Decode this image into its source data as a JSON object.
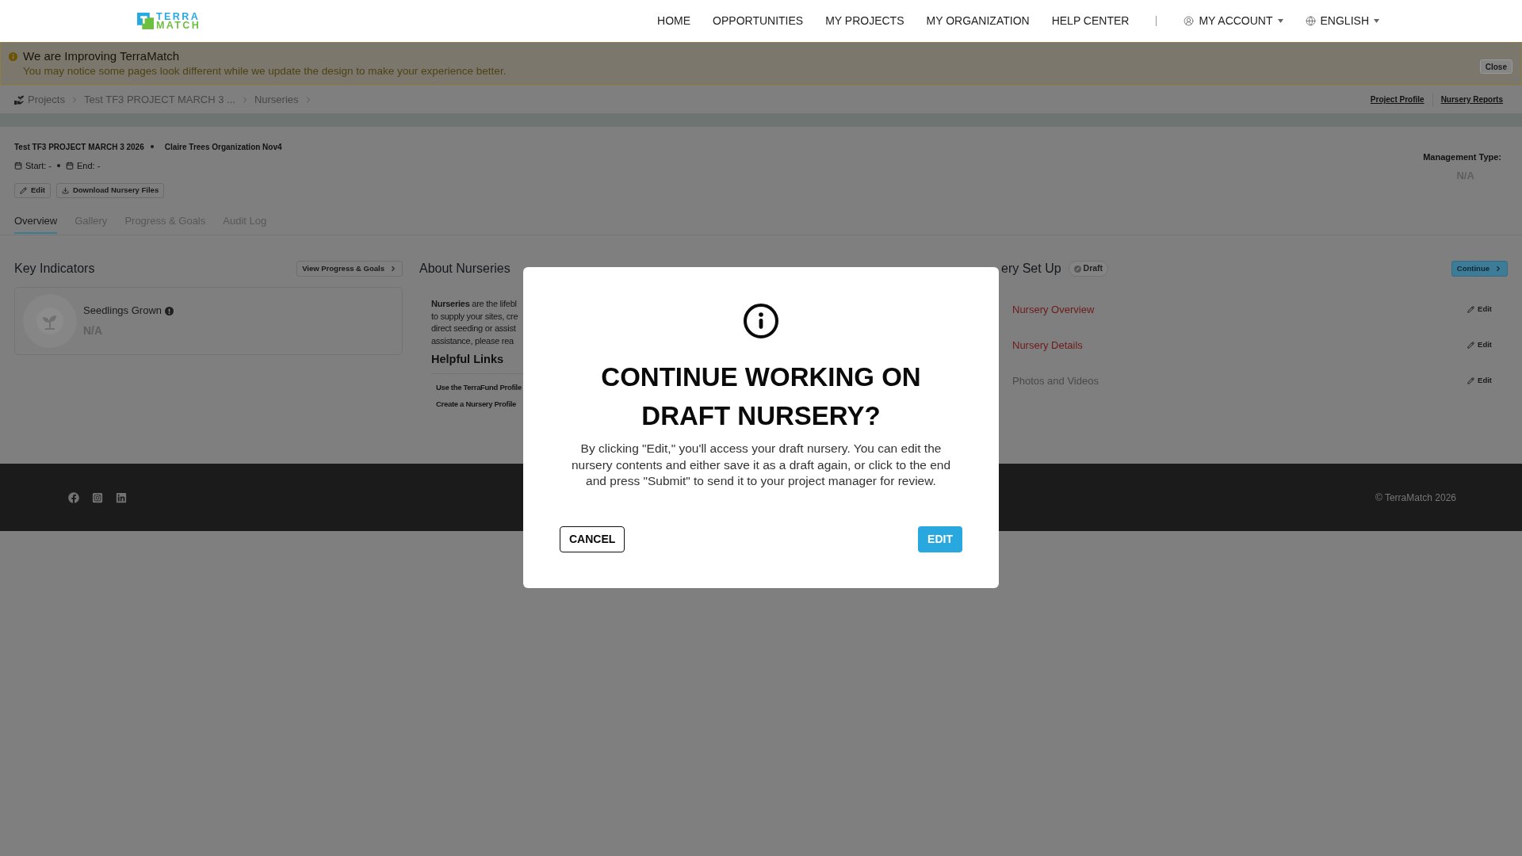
{
  "header": {
    "logo": {
      "words": [
        "TERRA",
        "MATCH"
      ]
    },
    "nav": [
      {
        "label": "HOME"
      },
      {
        "label": "OPPORTUNITIES"
      },
      {
        "label": "MY PROJECTS"
      },
      {
        "label": "MY ORGANIZATION"
      },
      {
        "label": "HELP CENTER"
      }
    ],
    "account": {
      "label": "MY ACCOUNT"
    },
    "language": {
      "label": "ENGLISH"
    }
  },
  "notice": {
    "title": "We are Improving TerraMatch",
    "message": "You may notice some pages look different while we update the design to make your experience better.",
    "close_label": "Close"
  },
  "breadcrumb": {
    "items": [
      "Projects",
      "Test TF3 PROJECT MARCH 3 ...",
      "Nurseries"
    ],
    "links": [
      "Project Profile",
      "Nursery Reports"
    ]
  },
  "project": {
    "name": "Test TF3 PROJECT MARCH 3 2026",
    "organization": "Claire Trees Organization Nov4",
    "start": "Start: -",
    "end": "End: -",
    "actions": [
      {
        "label": "Edit",
        "kind": "edit"
      },
      {
        "label": "Download Nursery Files",
        "kind": "download"
      }
    ],
    "management_type": {
      "label": "Management Type:",
      "value": "N/A"
    }
  },
  "tabs": [
    {
      "label": "Overview",
      "selected": true
    },
    {
      "label": "Gallery",
      "selected": false
    },
    {
      "label": "Progress & Goals",
      "selected": false
    },
    {
      "label": "Audit Log",
      "selected": false
    }
  ],
  "key_indicators": {
    "title": "Key Indicators",
    "button": "View Progress & Goals",
    "items": [
      {
        "label": "Seedlings Grown",
        "value": "N/A"
      }
    ]
  },
  "about": {
    "title": "About Nurseries",
    "paragraph_lines": [
      "**Nurseries** are the lifebl",
      "to supply your sites, cre",
      "direct seeding or assist",
      "assistance, please rea"
    ],
    "links_title": "Helpful Links",
    "links": [
      "Use the TerraFund Profile",
      "Create a Nursery Profile"
    ]
  },
  "setup": {
    "title": "ery Set Up",
    "status": "Draft",
    "continue": "Continue",
    "steps": [
      {
        "label": "Nursery Overview",
        "has_error": true,
        "action": "Edit"
      },
      {
        "label": "Nursery Details",
        "has_error": true,
        "action": "Edit"
      },
      {
        "label": "Photos and Videos",
        "has_error": false,
        "action": "Edit"
      }
    ]
  },
  "footer": {
    "copyright": "© TerraMatch 2026"
  },
  "dialog": {
    "title": "CONTINUE WORKING ON DRAFT NURSERY?",
    "message": "By clicking \"Edit,\" you'll access your draft nursery. You can edit the nursery contents and either save it as a draft again, or click to the end and press \"Submit\" to send it to your project manager for review.",
    "buttons": [
      {
        "label": "CANCEL",
        "kind": "secondary"
      },
      {
        "label": "EDIT",
        "kind": "primary"
      }
    ]
  }
}
